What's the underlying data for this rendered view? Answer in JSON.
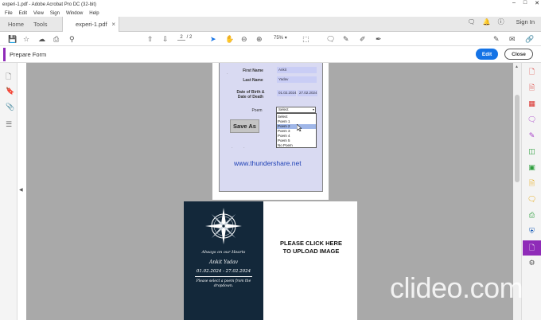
{
  "window": {
    "title": "experi-1.pdf - Adobe Acrobat Pro DC (32-bit)",
    "menu": [
      "File",
      "Edit",
      "View",
      "Sign",
      "Window",
      "Help"
    ]
  },
  "tabs": {
    "home": "Home",
    "tools": "Tools",
    "doc": "experi-1.pdf",
    "close": "×"
  },
  "header": {
    "sign_in": "Sign In"
  },
  "toolbar": {
    "page_current": "2",
    "page_total": "/ 2",
    "zoom": "75%"
  },
  "prepare_form": {
    "title": "Prepare Form",
    "edit": "Edit",
    "close": "Close"
  },
  "form": {
    "first_name_label": "First Name",
    "first_name_value": "Ankit",
    "last_name_label": "Last Name",
    "last_name_value": "Yadav",
    "dates_label_1": "Date of Birth &",
    "dates_label_2": "Date of Death",
    "dob_value": "01.02.2024",
    "dod_value": "27.02.2024",
    "poem_label": "Poem",
    "poem_selected": "Select",
    "poem_options": [
      "Select",
      "Poem 1",
      "Poem 2",
      "Poem 3",
      "Poem 4",
      "Poem 5",
      "No Poem"
    ],
    "save_as": "Save As",
    "website": "www.thundershare.net"
  },
  "page2": {
    "line1": "Always on our Hearts",
    "name": "Ankit Yadav",
    "dates": "01.02.2024 - 27.02.2024",
    "note_1": "Please select a poem from the",
    "note_2": "dropdown.",
    "upload_1": "PLEASE CLICK HERE",
    "upload_2": "TO UPLOAD IMAGE"
  },
  "watermark": "clideo.com",
  "colors": {
    "accent": "#8f2bb8",
    "edit_button": "#1473e6",
    "memorial_bg": "#13283a",
    "form_bg": "#d9daf2",
    "link": "#1d3fb5"
  }
}
